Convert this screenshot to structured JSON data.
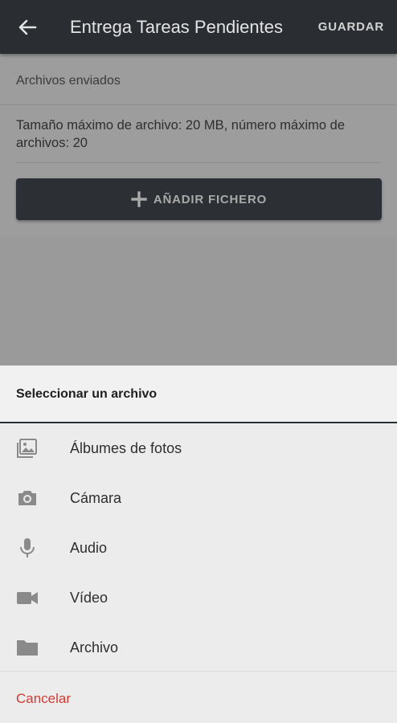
{
  "appbar": {
    "title": "Entrega Tareas Pendientes",
    "save_label": "GUARDAR"
  },
  "content": {
    "sent_files_label": "Archivos enviados",
    "limits_text": "Tamaño máximo de archivo: 20 MB, número máximo de archivos: 20",
    "add_file_label": "AÑADIR FICHERO"
  },
  "sheet": {
    "title": "Seleccionar un archivo",
    "options": [
      {
        "label": "Álbumes de fotos",
        "icon": "photo-album-icon"
      },
      {
        "label": "Cámara",
        "icon": "camera-icon"
      },
      {
        "label": "Audio",
        "icon": "microphone-icon"
      },
      {
        "label": "Vídeo",
        "icon": "video-camera-icon"
      },
      {
        "label": "Archivo",
        "icon": "folder-icon"
      }
    ],
    "cancel_label": "Cancelar"
  },
  "colors": {
    "appbar_bg": "#2a2d31",
    "cancel_text": "#d23a32",
    "scrim": "#9d9d9d"
  }
}
